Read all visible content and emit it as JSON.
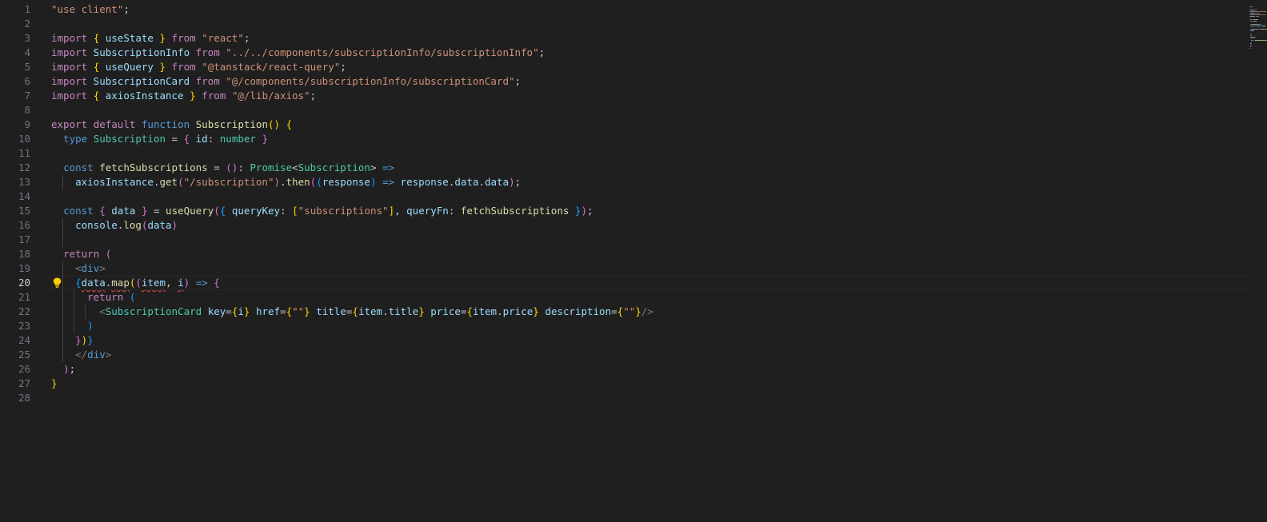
{
  "editor": {
    "active_line": 20,
    "lines": [
      {
        "n": "1",
        "guides": 0,
        "tokens": [
          {
            "t": "\"use client\"",
            "c": "str"
          },
          {
            "t": ";",
            "c": "punct"
          }
        ]
      },
      {
        "n": "2",
        "guides": 0,
        "tokens": []
      },
      {
        "n": "3",
        "guides": 0,
        "tokens": [
          {
            "t": "import",
            "c": "kw"
          },
          {
            "t": " ",
            "c": "punct"
          },
          {
            "t": "{",
            "c": "b1"
          },
          {
            "t": " useState ",
            "c": "var"
          },
          {
            "t": "}",
            "c": "b1"
          },
          {
            "t": " ",
            "c": "punct"
          },
          {
            "t": "from",
            "c": "kw"
          },
          {
            "t": " ",
            "c": "punct"
          },
          {
            "t": "\"react\"",
            "c": "str"
          },
          {
            "t": ";",
            "c": "punct"
          }
        ]
      },
      {
        "n": "4",
        "guides": 0,
        "tokens": [
          {
            "t": "import",
            "c": "kw"
          },
          {
            "t": " SubscriptionInfo ",
            "c": "var"
          },
          {
            "t": "from",
            "c": "kw"
          },
          {
            "t": " ",
            "c": "punct"
          },
          {
            "t": "\"../../components/subscriptionInfo/subscriptionInfo\"",
            "c": "str"
          },
          {
            "t": ";",
            "c": "punct"
          }
        ]
      },
      {
        "n": "5",
        "guides": 0,
        "tokens": [
          {
            "t": "import",
            "c": "kw"
          },
          {
            "t": " ",
            "c": "punct"
          },
          {
            "t": "{",
            "c": "b1"
          },
          {
            "t": " useQuery ",
            "c": "var"
          },
          {
            "t": "}",
            "c": "b1"
          },
          {
            "t": " ",
            "c": "punct"
          },
          {
            "t": "from",
            "c": "kw"
          },
          {
            "t": " ",
            "c": "punct"
          },
          {
            "t": "\"@tanstack/react-query\"",
            "c": "str"
          },
          {
            "t": ";",
            "c": "punct"
          }
        ]
      },
      {
        "n": "6",
        "guides": 0,
        "tokens": [
          {
            "t": "import",
            "c": "kw"
          },
          {
            "t": " SubscriptionCard ",
            "c": "var"
          },
          {
            "t": "from",
            "c": "kw"
          },
          {
            "t": " ",
            "c": "punct"
          },
          {
            "t": "\"@/components/subscriptionInfo/subscriptionCard\"",
            "c": "str"
          },
          {
            "t": ";",
            "c": "punct"
          }
        ]
      },
      {
        "n": "7",
        "guides": 0,
        "tokens": [
          {
            "t": "import",
            "c": "kw"
          },
          {
            "t": " ",
            "c": "punct"
          },
          {
            "t": "{",
            "c": "b1"
          },
          {
            "t": " axiosInstance ",
            "c": "var"
          },
          {
            "t": "}",
            "c": "b1"
          },
          {
            "t": " ",
            "c": "punct"
          },
          {
            "t": "from",
            "c": "kw"
          },
          {
            "t": " ",
            "c": "punct"
          },
          {
            "t": "\"@/lib/axios\"",
            "c": "str"
          },
          {
            "t": ";",
            "c": "punct"
          }
        ]
      },
      {
        "n": "8",
        "guides": 0,
        "tokens": []
      },
      {
        "n": "9",
        "guides": 0,
        "tokens": [
          {
            "t": "export",
            "c": "kw"
          },
          {
            "t": " ",
            "c": "punct"
          },
          {
            "t": "default",
            "c": "kw"
          },
          {
            "t": " ",
            "c": "punct"
          },
          {
            "t": "function",
            "c": "kw2"
          },
          {
            "t": " ",
            "c": "punct"
          },
          {
            "t": "Subscription",
            "c": "fn"
          },
          {
            "t": "()",
            "c": "b1"
          },
          {
            "t": " ",
            "c": "punct"
          },
          {
            "t": "{",
            "c": "b1"
          }
        ]
      },
      {
        "n": "10",
        "guides": 0,
        "tokens": [
          {
            "t": "  ",
            "c": "punct"
          },
          {
            "t": "type",
            "c": "kw2"
          },
          {
            "t": " ",
            "c": "punct"
          },
          {
            "t": "Subscription",
            "c": "type"
          },
          {
            "t": " = ",
            "c": "punct"
          },
          {
            "t": "{",
            "c": "b2"
          },
          {
            "t": " ",
            "c": "punct"
          },
          {
            "t": "id",
            "c": "var"
          },
          {
            "t": ": ",
            "c": "punct"
          },
          {
            "t": "number",
            "c": "type"
          },
          {
            "t": " ",
            "c": "punct"
          },
          {
            "t": "}",
            "c": "b2"
          }
        ]
      },
      {
        "n": "11",
        "guides": 0,
        "tokens": []
      },
      {
        "n": "12",
        "guides": 0,
        "tokens": [
          {
            "t": "  ",
            "c": "punct"
          },
          {
            "t": "const",
            "c": "kw2"
          },
          {
            "t": " ",
            "c": "punct"
          },
          {
            "t": "fetchSubscriptions",
            "c": "fn"
          },
          {
            "t": " = ",
            "c": "punct"
          },
          {
            "t": "()",
            "c": "b2"
          },
          {
            "t": ": ",
            "c": "punct"
          },
          {
            "t": "Promise",
            "c": "type"
          },
          {
            "t": "<",
            "c": "punct"
          },
          {
            "t": "Subscription",
            "c": "type"
          },
          {
            "t": "> ",
            "c": "punct"
          },
          {
            "t": "=>",
            "c": "kw2"
          }
        ]
      },
      {
        "n": "13",
        "guides": 1,
        "tokens": [
          {
            "t": "    ",
            "c": "punct"
          },
          {
            "t": "axiosInstance",
            "c": "var"
          },
          {
            "t": ".",
            "c": "punct"
          },
          {
            "t": "get",
            "c": "fn"
          },
          {
            "t": "(",
            "c": "b2"
          },
          {
            "t": "\"/subscription\"",
            "c": "str"
          },
          {
            "t": ")",
            "c": "b2"
          },
          {
            "t": ".",
            "c": "punct"
          },
          {
            "t": "then",
            "c": "fn"
          },
          {
            "t": "(",
            "c": "b2"
          },
          {
            "t": "(",
            "c": "b3"
          },
          {
            "t": "response",
            "c": "var"
          },
          {
            "t": ")",
            "c": "b3"
          },
          {
            "t": " ",
            "c": "punct"
          },
          {
            "t": "=>",
            "c": "kw2"
          },
          {
            "t": " ",
            "c": "punct"
          },
          {
            "t": "response",
            "c": "var"
          },
          {
            "t": ".",
            "c": "punct"
          },
          {
            "t": "data",
            "c": "var"
          },
          {
            "t": ".",
            "c": "punct"
          },
          {
            "t": "data",
            "c": "var"
          },
          {
            "t": ")",
            "c": "b2"
          },
          {
            "t": ";",
            "c": "punct"
          }
        ]
      },
      {
        "n": "14",
        "guides": 0,
        "tokens": []
      },
      {
        "n": "15",
        "guides": 0,
        "tokens": [
          {
            "t": "  ",
            "c": "punct"
          },
          {
            "t": "const",
            "c": "kw2"
          },
          {
            "t": " ",
            "c": "punct"
          },
          {
            "t": "{",
            "c": "b2"
          },
          {
            "t": " ",
            "c": "punct"
          },
          {
            "t": "data",
            "c": "var"
          },
          {
            "t": " ",
            "c": "punct"
          },
          {
            "t": "}",
            "c": "b2"
          },
          {
            "t": " = ",
            "c": "punct"
          },
          {
            "t": "useQuery",
            "c": "fn"
          },
          {
            "t": "(",
            "c": "b2"
          },
          {
            "t": "{",
            "c": "b3"
          },
          {
            "t": " ",
            "c": "punct"
          },
          {
            "t": "queryKey",
            "c": "var"
          },
          {
            "t": ": ",
            "c": "punct"
          },
          {
            "t": "[",
            "c": "b1"
          },
          {
            "t": "\"subscriptions\"",
            "c": "str"
          },
          {
            "t": "]",
            "c": "b1"
          },
          {
            "t": ", ",
            "c": "punct"
          },
          {
            "t": "queryFn",
            "c": "var"
          },
          {
            "t": ": ",
            "c": "punct"
          },
          {
            "t": "fetchSubscriptions",
            "c": "fn"
          },
          {
            "t": " ",
            "c": "punct"
          },
          {
            "t": "}",
            "c": "b3"
          },
          {
            "t": ")",
            "c": "b2"
          },
          {
            "t": ";",
            "c": "punct"
          }
        ]
      },
      {
        "n": "16",
        "guides": 1,
        "tokens": [
          {
            "t": "    ",
            "c": "punct"
          },
          {
            "t": "console",
            "c": "var"
          },
          {
            "t": ".",
            "c": "punct"
          },
          {
            "t": "log",
            "c": "fn"
          },
          {
            "t": "(",
            "c": "b2"
          },
          {
            "t": "data",
            "c": "var"
          },
          {
            "t": ")",
            "c": "b2"
          }
        ]
      },
      {
        "n": "17",
        "guides": 1,
        "tokens": []
      },
      {
        "n": "18",
        "guides": 0,
        "tokens": [
          {
            "t": "  ",
            "c": "punct"
          },
          {
            "t": "return",
            "c": "kw"
          },
          {
            "t": " ",
            "c": "punct"
          },
          {
            "t": "(",
            "c": "b2"
          }
        ]
      },
      {
        "n": "19",
        "guides": 1,
        "tokens": [
          {
            "t": "    ",
            "c": "punct"
          },
          {
            "t": "<",
            "c": "tag"
          },
          {
            "t": "div",
            "c": "html"
          },
          {
            "t": ">",
            "c": "tag"
          }
        ]
      },
      {
        "n": "20",
        "guides": 1,
        "bulb": true,
        "tokens": [
          {
            "t": "    ",
            "c": "punct"
          },
          {
            "t": "{",
            "c": "b3"
          },
          {
            "t": "data",
            "c": "var",
            "squig": true
          },
          {
            "t": ".",
            "c": "punct"
          },
          {
            "t": "map",
            "c": "fn",
            "squig": true
          },
          {
            "t": "(",
            "c": "b1"
          },
          {
            "t": "(",
            "c": "b2"
          },
          {
            "t": "item",
            "c": "var",
            "squig": true
          },
          {
            "t": ", ",
            "c": "punct"
          },
          {
            "t": "i",
            "c": "var",
            "squig": true
          },
          {
            "t": ")",
            "c": "b2"
          },
          {
            "t": " ",
            "c": "punct"
          },
          {
            "t": "=>",
            "c": "kw2"
          },
          {
            "t": " ",
            "c": "punct"
          },
          {
            "t": "{",
            "c": "b2"
          }
        ]
      },
      {
        "n": "21",
        "guides": 2,
        "tokens": [
          {
            "t": "      ",
            "c": "punct"
          },
          {
            "t": "return",
            "c": "kw"
          },
          {
            "t": " ",
            "c": "punct"
          },
          {
            "t": "(",
            "c": "b3"
          }
        ]
      },
      {
        "n": "22",
        "guides": 3,
        "tokens": [
          {
            "t": "        ",
            "c": "punct"
          },
          {
            "t": "<",
            "c": "tag"
          },
          {
            "t": "SubscriptionCard",
            "c": "comp"
          },
          {
            "t": " ",
            "c": "punct"
          },
          {
            "t": "key",
            "c": "var"
          },
          {
            "t": "=",
            "c": "punct"
          },
          {
            "t": "{",
            "c": "b1"
          },
          {
            "t": "i",
            "c": "var"
          },
          {
            "t": "}",
            "c": "b1"
          },
          {
            "t": " ",
            "c": "punct"
          },
          {
            "t": "href",
            "c": "var"
          },
          {
            "t": "=",
            "c": "punct"
          },
          {
            "t": "{",
            "c": "b1"
          },
          {
            "t": "\"\"",
            "c": "str"
          },
          {
            "t": "}",
            "c": "b1"
          },
          {
            "t": " ",
            "c": "punct"
          },
          {
            "t": "title",
            "c": "var"
          },
          {
            "t": "=",
            "c": "punct"
          },
          {
            "t": "{",
            "c": "b1"
          },
          {
            "t": "item",
            "c": "var"
          },
          {
            "t": ".",
            "c": "punct"
          },
          {
            "t": "title",
            "c": "var"
          },
          {
            "t": "}",
            "c": "b1"
          },
          {
            "t": " ",
            "c": "punct"
          },
          {
            "t": "price",
            "c": "var"
          },
          {
            "t": "=",
            "c": "punct"
          },
          {
            "t": "{",
            "c": "b1"
          },
          {
            "t": "item",
            "c": "var"
          },
          {
            "t": ".",
            "c": "punct"
          },
          {
            "t": "price",
            "c": "var"
          },
          {
            "t": "}",
            "c": "b1"
          },
          {
            "t": " ",
            "c": "punct"
          },
          {
            "t": "description",
            "c": "var"
          },
          {
            "t": "=",
            "c": "punct"
          },
          {
            "t": "{",
            "c": "b1"
          },
          {
            "t": "\"\"",
            "c": "str"
          },
          {
            "t": "}",
            "c": "b1"
          },
          {
            "t": "/>",
            "c": "tag"
          }
        ]
      },
      {
        "n": "23",
        "guides": 2,
        "tokens": [
          {
            "t": "      ",
            "c": "punct"
          },
          {
            "t": ")",
            "c": "b3"
          }
        ]
      },
      {
        "n": "24",
        "guides": 1,
        "tokens": [
          {
            "t": "    ",
            "c": "punct"
          },
          {
            "t": "}",
            "c": "b2"
          },
          {
            "t": ")",
            "c": "b1"
          },
          {
            "t": "}",
            "c": "b3"
          }
        ]
      },
      {
        "n": "25",
        "guides": 1,
        "tokens": [
          {
            "t": "    ",
            "c": "punct"
          },
          {
            "t": "</",
            "c": "tag"
          },
          {
            "t": "div",
            "c": "html"
          },
          {
            "t": ">",
            "c": "tag"
          }
        ]
      },
      {
        "n": "26",
        "guides": 0,
        "tokens": [
          {
            "t": "  ",
            "c": "punct"
          },
          {
            "t": ")",
            "c": "b2"
          },
          {
            "t": ";",
            "c": "punct"
          }
        ]
      },
      {
        "n": "27",
        "guides": 0,
        "tokens": [
          {
            "t": "}",
            "c": "b1"
          }
        ]
      },
      {
        "n": "28",
        "guides": 0,
        "tokens": []
      }
    ]
  },
  "icons": {
    "lightbulb": "lightbulb-icon"
  },
  "colors": {
    "background": "#1f1f1f",
    "lightbulb": "#ffcc00",
    "error_squiggle": "#f14c4c"
  }
}
